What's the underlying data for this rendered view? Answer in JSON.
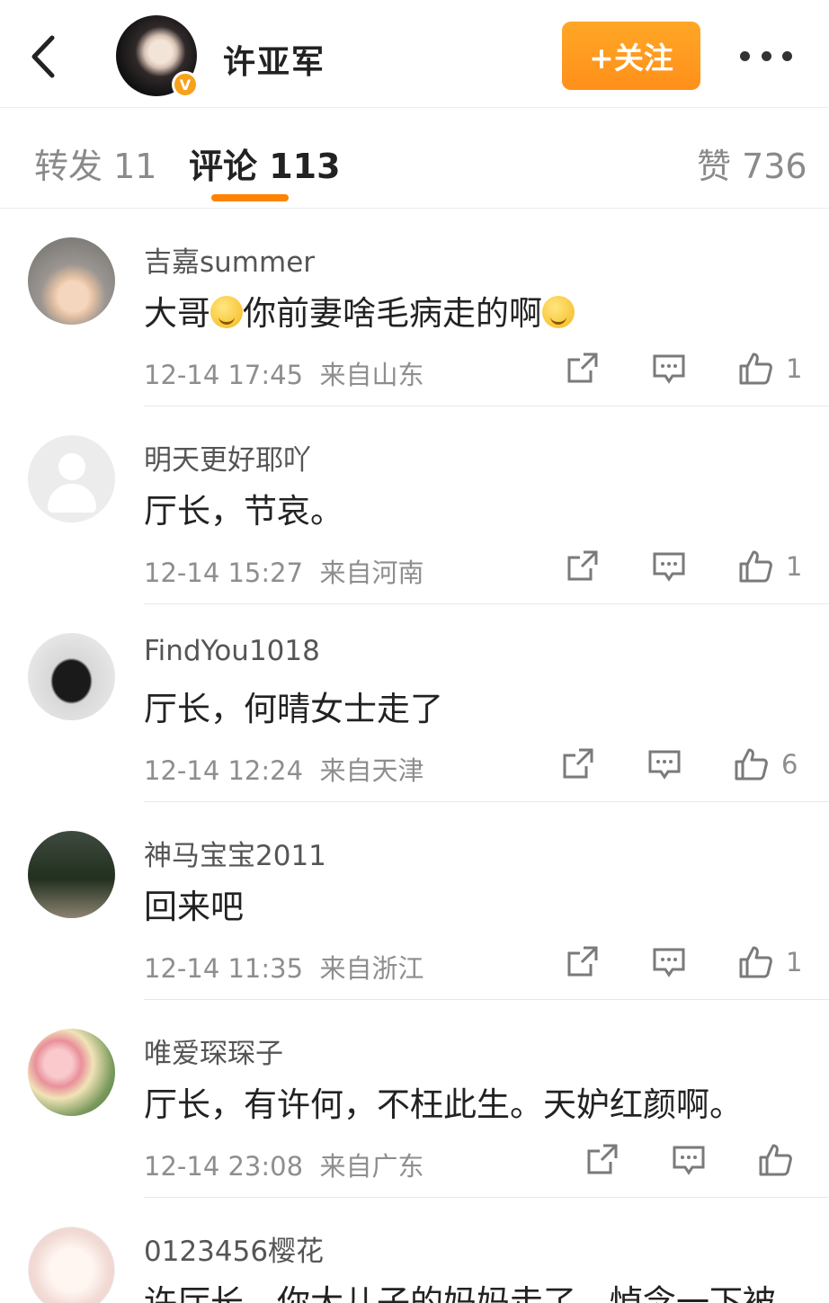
{
  "header": {
    "user_name": "许亚军",
    "badge": "V",
    "follow_label": "+关注"
  },
  "tabs": [
    {
      "label": "转发 11"
    },
    {
      "label": "评论 113"
    },
    {
      "label": "赞 736"
    }
  ],
  "colors": {
    "accent": "#ff8200",
    "follow_button": "#ffa726",
    "badge": "#f7a21b"
  },
  "comments": [
    {
      "name": "吉嘉summer",
      "text_a": "大哥",
      "text_b": "你前妻啥毛病走的啊",
      "time": "12-14 17:45",
      "source": "来自山东",
      "likes": "1"
    },
    {
      "name": "明天更好耶吖",
      "text": "厅长，节哀。",
      "time": "12-14 15:27",
      "source": "来自河南",
      "likes": "1"
    },
    {
      "name": "FindYou1018",
      "text": "厅长，何晴女士走了",
      "time": "12-14 12:24",
      "source": "来自天津",
      "likes": "6"
    },
    {
      "name": "神马宝宝2011",
      "text": "回来吧",
      "time": "12-14 11:35",
      "source": "来自浙江",
      "likes": "1"
    },
    {
      "name": "唯爱琛琛子",
      "text": "厅长，有许何，不枉此生。天妒红颜啊。",
      "time": "12-14 23:08",
      "source": "来自广东",
      "likes": ""
    },
    {
      "name": "0123456樱花",
      "text": "许厅长，你大儿子的妈妈走了，悼念一下被，",
      "time": "",
      "source": "",
      "likes": ""
    }
  ]
}
